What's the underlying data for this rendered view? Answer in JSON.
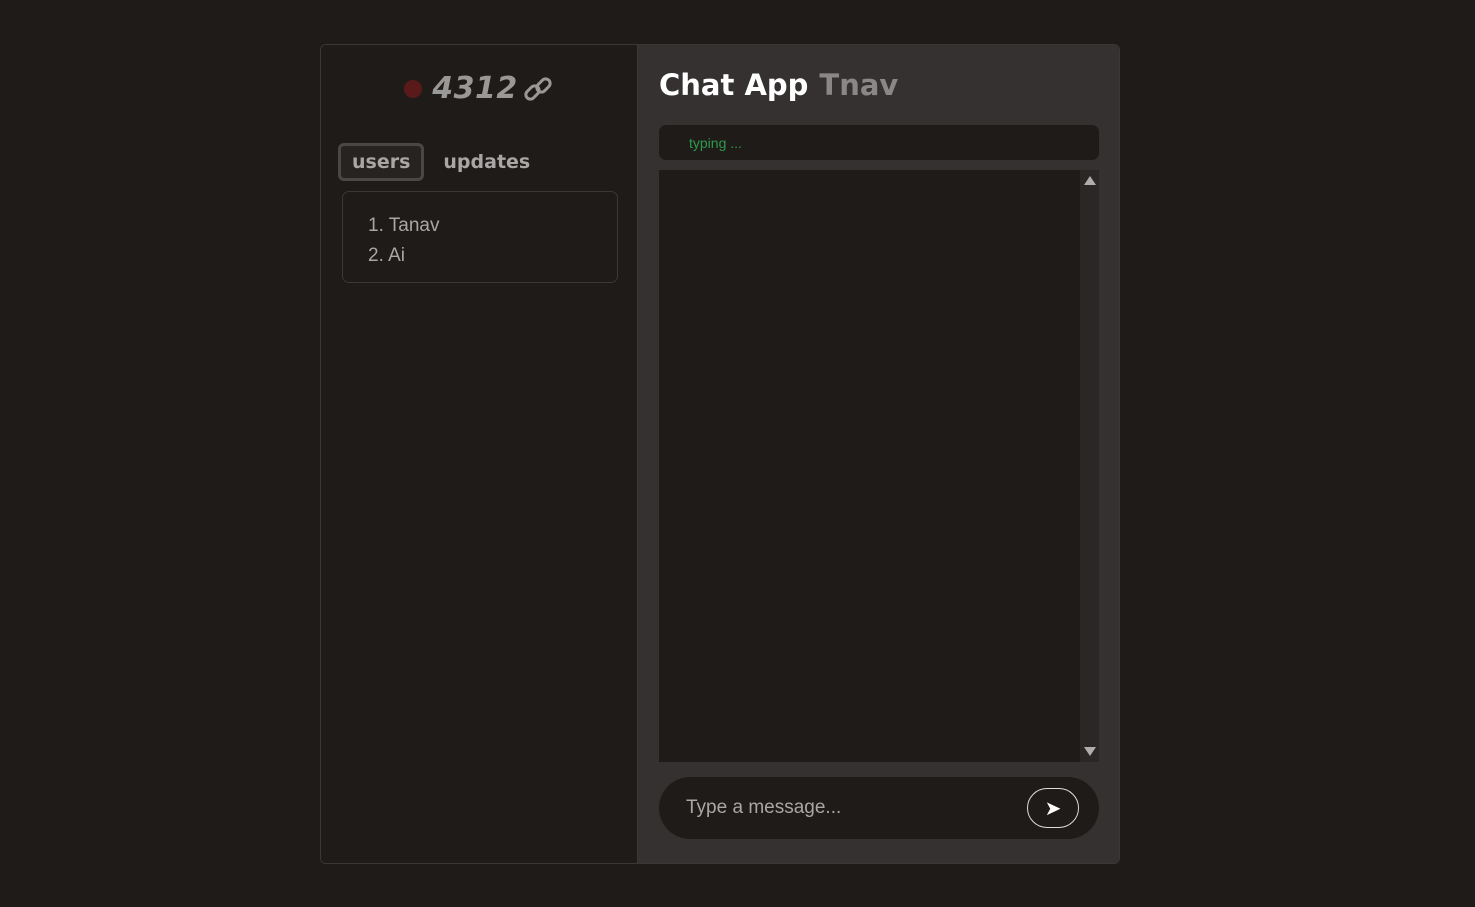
{
  "room": {
    "code": "4312",
    "status_dot_color": "#5a1a1a",
    "link_icon": "link-icon"
  },
  "tabs": [
    {
      "label": "users",
      "active": true
    },
    {
      "label": "updates",
      "active": false
    }
  ],
  "users": [
    {
      "label": "1. Tanav"
    },
    {
      "label": "2. Ai"
    }
  ],
  "header": {
    "title": "Chat App",
    "subtitle": "Tnav"
  },
  "typing": {
    "text": "typing ..."
  },
  "composer": {
    "placeholder": "Type a message...",
    "send_icon": "send-arrow-icon",
    "send_glyph": "➤"
  },
  "colors": {
    "background": "#1e1b19",
    "panel": "#343130",
    "typing_text": "#2e9a4a"
  }
}
